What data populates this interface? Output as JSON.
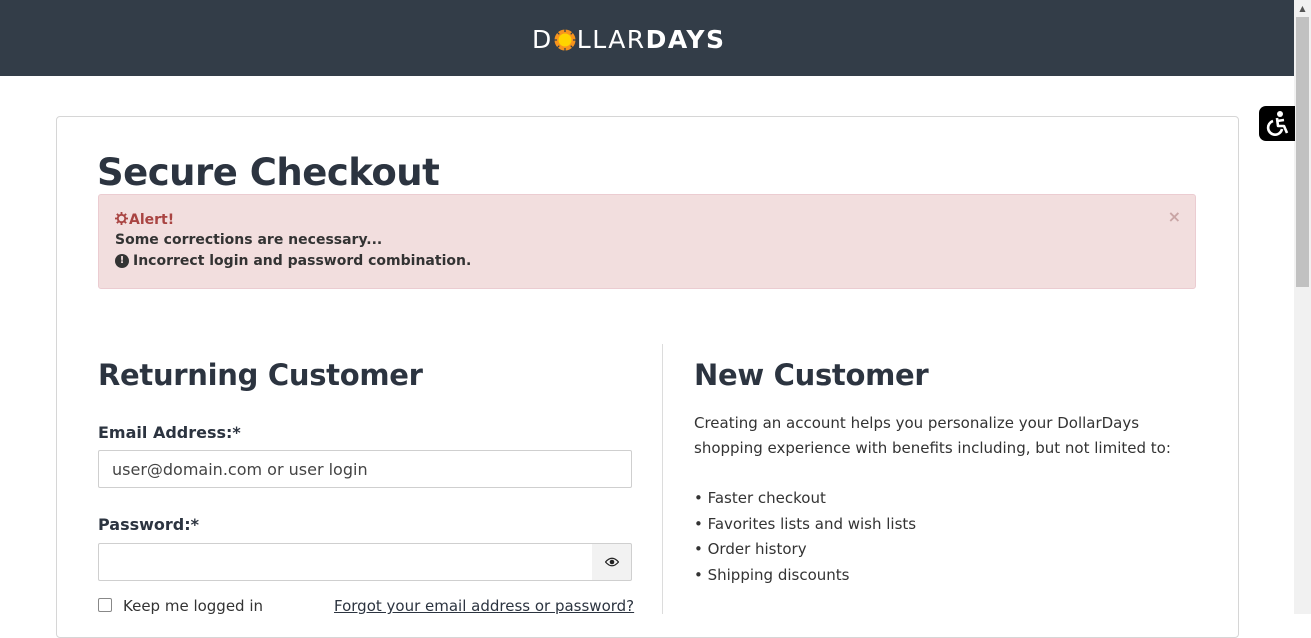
{
  "header": {
    "logo_part1": "D",
    "logo_part2": "LLAR",
    "logo_part3": "DAYS",
    "bg_color": "#333d48"
  },
  "page": {
    "title": "Secure Checkout"
  },
  "alert": {
    "title": "Alert!",
    "subtitle": "Some corrections are necessary...",
    "message": "Incorrect login and password combination.",
    "close_label": "×",
    "bg_color": "#f2dede"
  },
  "returning": {
    "title": "Returning Customer",
    "email_label": "Email Address:*",
    "email_placeholder": "user@domain.com or user login",
    "password_label": "Password:*",
    "keep_logged_label": "Keep me logged in",
    "forgot_link": "Forgot your email address or password?"
  },
  "new_customer": {
    "title": "New Customer",
    "intro": "Creating an account helps you personalize your DollarDays shopping experience with benefits including, but not limited to:",
    "benefits": [
      "• Faster checkout",
      "• Favorites lists and wish lists",
      "• Order history",
      "• Shipping discounts"
    ]
  },
  "icons": [
    "sun-logo-icon",
    "accessibility-icon",
    "gear-icon",
    "exclamation-circle-icon",
    "eye-icon",
    "close-icon"
  ]
}
